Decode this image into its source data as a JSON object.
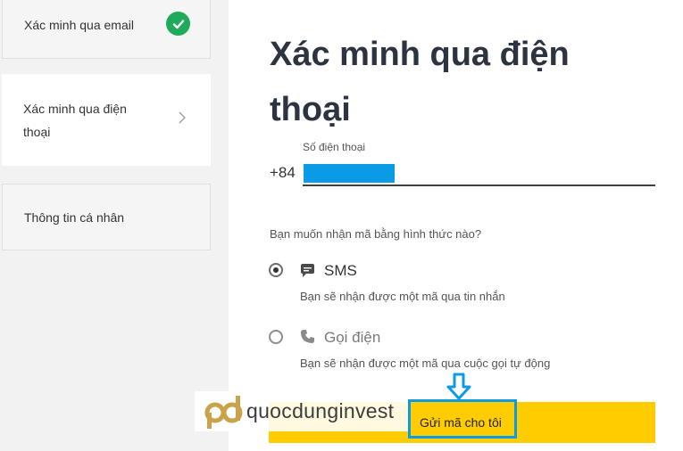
{
  "sidebar": {
    "steps": [
      {
        "label": "Xác minh qua email",
        "state": "completed",
        "icon": "check-circle-icon"
      },
      {
        "label": "Xác minh qua điện thoại",
        "state": "active",
        "icon": "chevron-right-icon"
      },
      {
        "label": "Thông tin cá nhân",
        "state": "pending"
      }
    ]
  },
  "main": {
    "title": "Xác minh qua điện thoại",
    "phone": {
      "label": "Số điện thoại",
      "country_code": "+84",
      "value_redacted": true
    },
    "question": "Bạn muốn nhận mã bằng hình thức nào?",
    "options": [
      {
        "title": "SMS",
        "description": "Bạn sẽ nhận được một mã qua tin nhắn",
        "selected": true,
        "icon": "message-bubble-icon"
      },
      {
        "title": "Gọi điện",
        "description": "Bạn sẽ nhận được một mã qua cuộc gọi tự động",
        "selected": false,
        "icon": "phone-icon"
      }
    ],
    "send_button": "Gửi mã cho tôi"
  },
  "watermark": {
    "text": "quocdunginvest"
  },
  "colors": {
    "accent_yellow": "#ffcc00",
    "success_green": "#1fab5b",
    "highlight_blue": "#0a9ae6",
    "title_dark": "#2b3440"
  }
}
